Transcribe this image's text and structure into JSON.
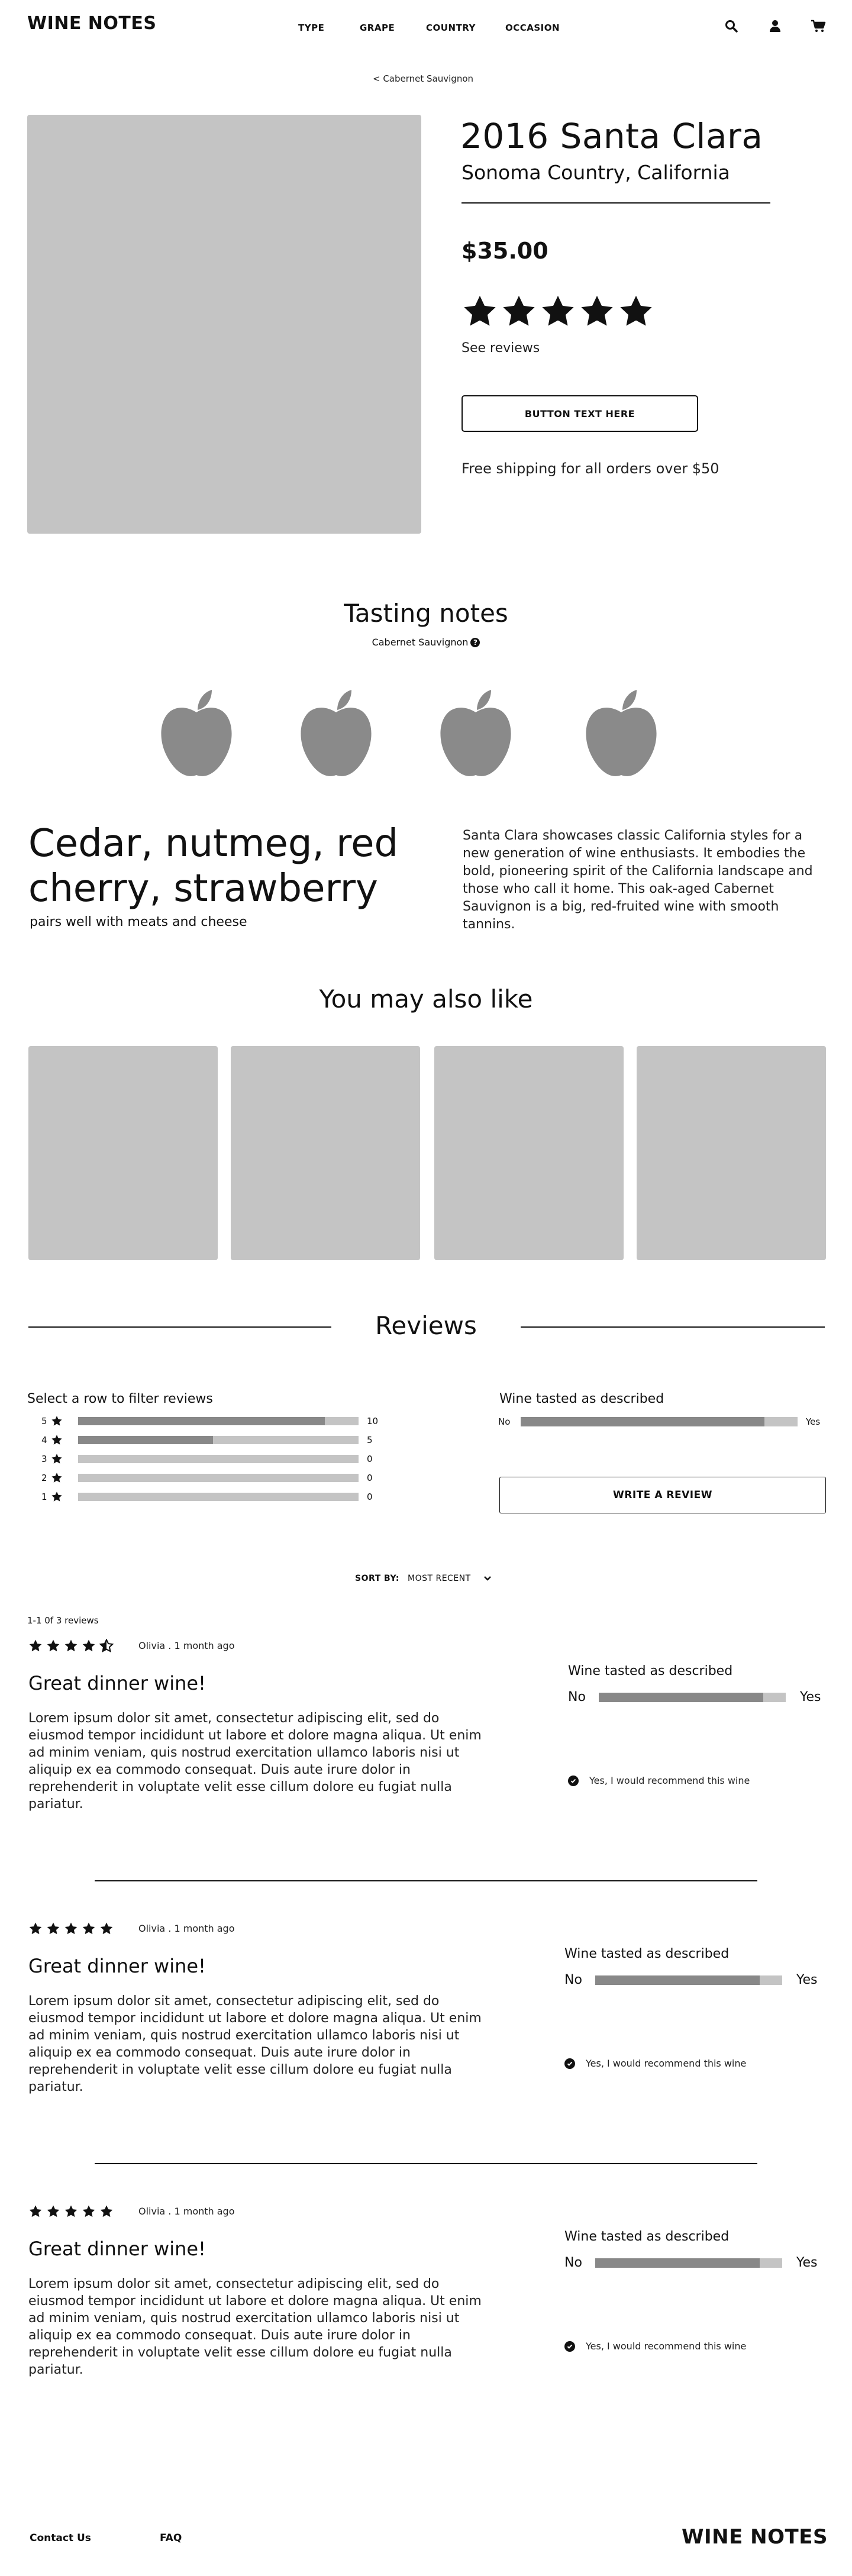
{
  "header": {
    "logo": "WINE NOTES",
    "nav": [
      "TYPE",
      "GRAPE",
      "COUNTRY",
      "OCCASION"
    ],
    "icons": [
      "search-icon",
      "user-icon",
      "cart-icon"
    ]
  },
  "breadcrumb": "< Cabernet Sauvignon",
  "product": {
    "title": "2016 Santa Clara",
    "region": "Sonoma Country, California",
    "price": "$35.00",
    "rating": 5,
    "see_reviews": "See reviews",
    "button": "BUTTON TEXT HERE",
    "shipping": "Free shipping for all orders over $50"
  },
  "tasting": {
    "title": "Tasting notes",
    "grape": "Cabernet Sauvignon",
    "help_icon": "?",
    "flavors": "Cedar, nutmeg, red cherry, strawberry",
    "pairing": "pairs well with meats and cheese",
    "description": "Santa Clara showcases classic California styles for a new generation of wine enthusiasts. It embodies the bold, pioneering spirit of the California landscape and those who call it home. This oak-aged Cabernet Sauvignon is a big, red-fruited wine with smooth tannins."
  },
  "also_like": {
    "title": "You may also like"
  },
  "reviews": {
    "title": "Reviews",
    "filter_label": "Select a row to filter reviews",
    "breakdown": [
      {
        "stars": "5",
        "count": "10",
        "fraction": 0.88
      },
      {
        "stars": "4",
        "count": "5",
        "fraction": 0.48
      },
      {
        "stars": "3",
        "count": "0",
        "fraction": 0
      },
      {
        "stars": "2",
        "count": "0",
        "fraction": 0
      },
      {
        "stars": "1",
        "count": "0",
        "fraction": 0
      }
    ],
    "described": {
      "title": "Wine tasted as described",
      "no": "No",
      "yes": "Yes",
      "fraction": 0.88
    },
    "write_button": "WRITE A REVIEW",
    "sort_label": "SORT BY:",
    "sort_value": "MOST RECENT",
    "count_text": "1-1 0f 3 reviews",
    "items": [
      {
        "rating": 4.5,
        "meta": "Olivia . 1 month ago",
        "title": "Great dinner wine!",
        "body": "Lorem ipsum dolor sit amet, consectetur adipiscing elit, sed do eiusmod tempor incididunt ut labore et dolore magna aliqua. Ut enim ad minim veniam, quis nostrud exercitation ullamco laboris nisi ut aliquip ex ea commodo consequat. Duis aute irure dolor in reprehenderit in voluptate velit esse cillum dolore eu fugiat nulla pariatur.",
        "described_title": "Wine tasted as described",
        "no": "No",
        "yes": "Yes",
        "described_fraction": 0.88,
        "recommend": "Yes, I would recommend this wine"
      },
      {
        "rating": 5,
        "meta": "Olivia . 1 month ago",
        "title": "Great dinner wine!",
        "body": "Lorem ipsum dolor sit amet, consectetur adipiscing elit, sed do eiusmod tempor incididunt ut labore et dolore magna aliqua. Ut enim ad minim veniam, quis nostrud exercitation ullamco laboris nisi ut aliquip ex ea commodo consequat. Duis aute irure dolor in reprehenderit in voluptate velit esse cillum dolore eu fugiat nulla pariatur.",
        "described_title": "Wine tasted as described",
        "no": "No",
        "yes": "Yes",
        "described_fraction": 0.88,
        "recommend": "Yes, I would recommend this wine"
      },
      {
        "rating": 5,
        "meta": "Olivia . 1 month ago",
        "title": "Great dinner wine!",
        "body": "Lorem ipsum dolor sit amet, consectetur adipiscing elit, sed do eiusmod tempor incididunt ut labore et dolore magna aliqua. Ut enim ad minim veniam, quis nostrud exercitation ullamco laboris nisi ut aliquip ex ea commodo consequat. Duis aute irure dolor in reprehenderit in voluptate velit esse cillum dolore eu fugiat nulla pariatur.",
        "described_title": "Wine tasted as described",
        "no": "No",
        "yes": "Yes",
        "described_fraction": 0.88,
        "recommend": "Yes, I would recommend this wine"
      }
    ]
  },
  "footer": {
    "contact": "Contact Us",
    "faq": "FAQ",
    "logo": "WINE NOTES"
  }
}
